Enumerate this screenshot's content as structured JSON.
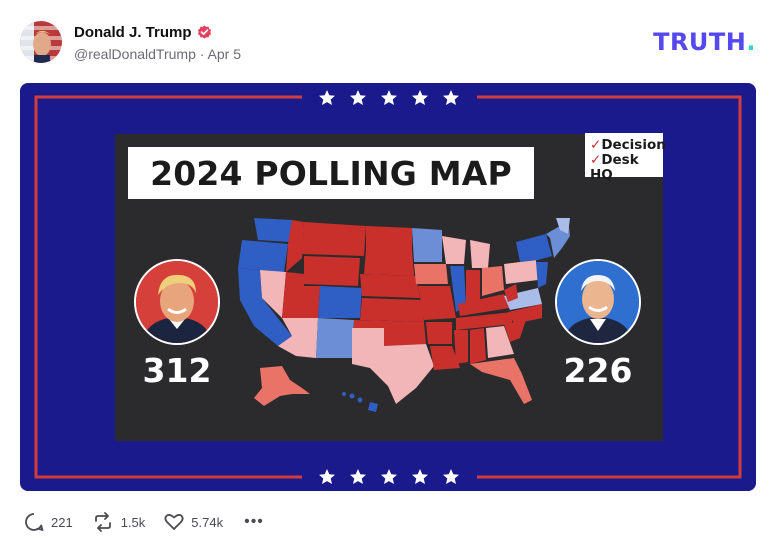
{
  "post": {
    "author_name": "Donald J. Trump",
    "handle": "@realDonaldTrump",
    "separator": "·",
    "date": "Apr 5",
    "verified_color": "#e4405f"
  },
  "brand": {
    "name": "TRUTH",
    "dot": "."
  },
  "image": {
    "title": "2024 POLLING MAP",
    "logo_line1": "Decision",
    "logo_line2": "Desk HQ",
    "left_score": "312",
    "right_score": "226",
    "colors": {
      "frame": "#1a1a8c",
      "border_red": "#d23c3c",
      "panel": "#2b2b2e",
      "solid_red": "#c9302c",
      "likely_red": "#e87366",
      "lean_red": "#f2b6b8",
      "solid_blue": "#2f5ec4",
      "likely_blue": "#6b8ed6",
      "lean_blue": "#a9bde8"
    }
  },
  "actions": {
    "replies": "221",
    "retruths": "1.5k",
    "likes": "5.74k",
    "more": "•••"
  }
}
